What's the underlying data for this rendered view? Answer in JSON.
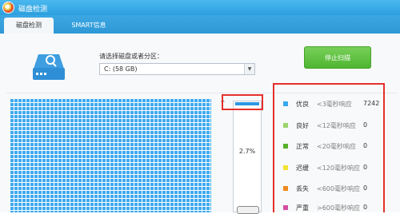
{
  "window": {
    "title": "磁盘检测"
  },
  "tabs": [
    {
      "label": "磁盘检测",
      "active": true
    },
    {
      "label": "SMART信息",
      "active": false
    }
  ],
  "disk_select": {
    "prompt": "请选择磁盘或者分区：",
    "selected": "C:  (58 GB)",
    "arrow_icon": "chevron-down-icon"
  },
  "stop_button": {
    "label": "停止扫描",
    "color": "#5bbf3a"
  },
  "progress": {
    "percent_text": "2.7%",
    "value": 2.7
  },
  "legend": [
    {
      "name": "优良",
      "range": "<3毫秒响应",
      "count": "7242",
      "color": "#3aa8ee"
    },
    {
      "name": "良好",
      "range": "<12毫秒响应",
      "count": "0",
      "color": "#9ad46a"
    },
    {
      "name": "正常",
      "range": "<20毫秒响应",
      "count": "0",
      "color": "#55b12a"
    },
    {
      "name": "迟缓",
      "range": "<120毫秒响应",
      "count": "0",
      "color": "#f2e333"
    },
    {
      "name": "丢失",
      "range": "<600毫秒响应",
      "count": "0",
      "color": "#f08a1e"
    },
    {
      "name": "严重",
      "range": ">600毫秒响应",
      "count": "0",
      "color": "#d44fa0"
    }
  ],
  "colors": {
    "titlebar": "#37a7e6",
    "block": "#3fa9f0",
    "highlight": "#e5302d"
  }
}
